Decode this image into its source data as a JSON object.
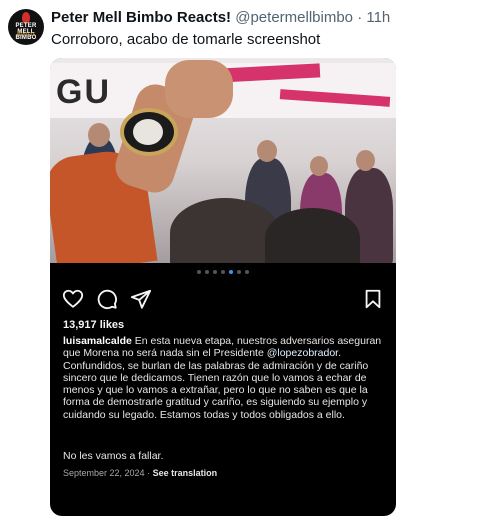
{
  "tweet": {
    "author_name": "Peter Mell Bimbo Reacts!",
    "handle": "@petermellbimbo",
    "separator": "·",
    "time": "11h",
    "text": "Corroboro, acabo de tomarle screenshot",
    "avatar_text_top": "PETER MELL BIMBO",
    "avatar_text_bottom": "Reacts"
  },
  "post": {
    "banner_text": "GU",
    "carousel": {
      "count": 7,
      "active_index": 4
    },
    "icons": [
      "heart-icon",
      "comment-icon",
      "share-icon",
      "bookmark-icon"
    ],
    "likes": "13,917 likes",
    "username": "luisamalcalde",
    "caption_part1": " En esta nueva etapa, nuestros adversarios aseguran que Morena no será nada sin el Presidente ",
    "mention": "@lopezobrador",
    "caption_part2": ". Confundidos, se burlan de las palabras de admiración y de cariño sincero que le dedicamos. Tienen razón que lo vamos a echar de menos y que lo vamos a extrañar, pero lo que no saben es que la forma de demostrarle gratitud y cariño, es siguiendo su ejemplo y cuidando su legado. Estamos todas y todos obligados a ello.",
    "closing": "No les vamos a fallar.",
    "date": "September 22, 2024",
    "meta_separator": "·",
    "see_translation": "See translation"
  },
  "colors": {
    "link_blue": "#3897f0",
    "banner_pink": "#d6336c",
    "card_bg": "#000000"
  }
}
